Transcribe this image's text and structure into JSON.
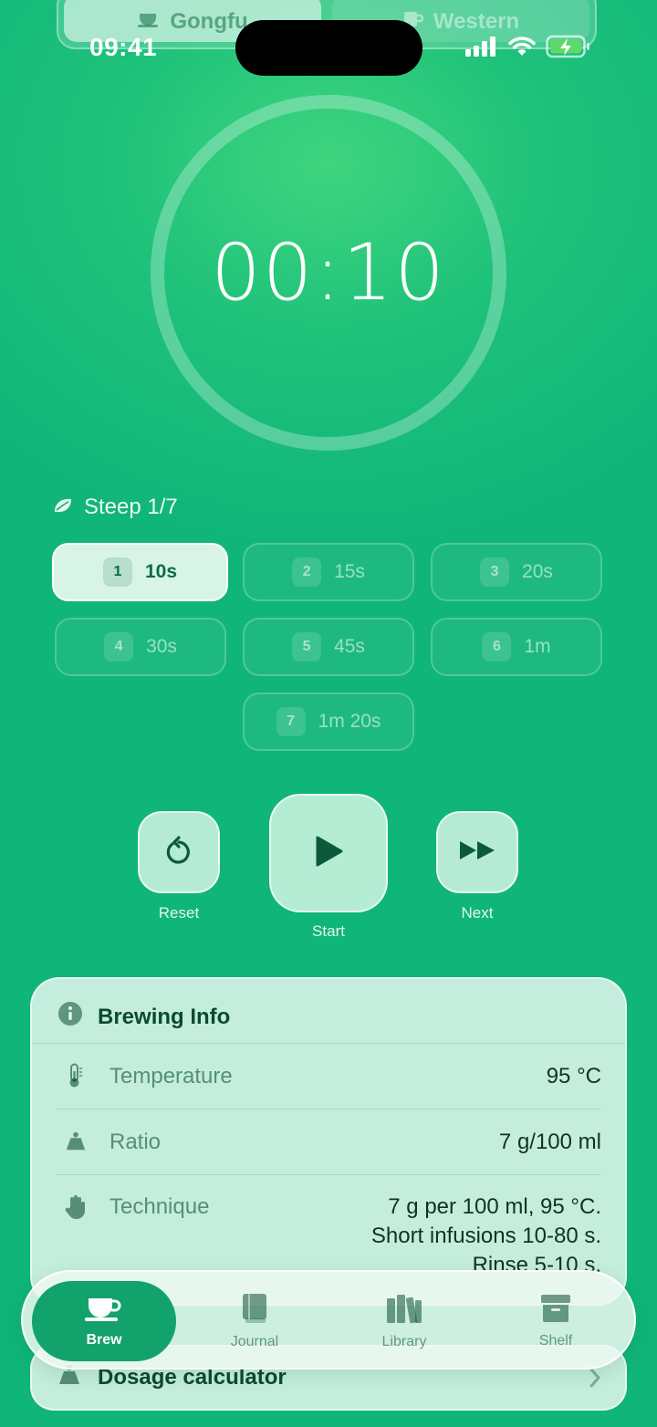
{
  "mode_selector": {
    "options": [
      "Gongfu",
      "Western"
    ],
    "selected": "Gongfu"
  },
  "status_bar": {
    "time": "09:41"
  },
  "timer": {
    "display": "00:10"
  },
  "steep": {
    "label": "Steep 1/7",
    "chips": [
      {
        "num": "1",
        "time": "10s",
        "active": true
      },
      {
        "num": "2",
        "time": "15s",
        "active": false
      },
      {
        "num": "3",
        "time": "20s",
        "active": false
      },
      {
        "num": "4",
        "time": "30s",
        "active": false
      },
      {
        "num": "5",
        "time": "45s",
        "active": false
      },
      {
        "num": "6",
        "time": "1m",
        "active": false
      },
      {
        "num": "7",
        "time": "1m 20s",
        "active": false
      }
    ]
  },
  "controls": {
    "reset_label": "Reset",
    "start_label": "Start",
    "next_label": "Next"
  },
  "brewing_info": {
    "title": "Brewing Info",
    "temperature_label": "Temperature",
    "temperature_value": "95 °C",
    "ratio_label": "Ratio",
    "ratio_value": "7 g/100 ml",
    "technique_label": "Technique",
    "technique_lines": [
      "7 g per 100 ml, 95 °C.",
      "Short infusions 10-80 s.",
      "Rinse 5-10 s."
    ]
  },
  "dosage_calculator": {
    "label": "Dosage calculator"
  },
  "tabs": [
    {
      "label": "Brew",
      "active": true
    },
    {
      "label": "Journal",
      "active": false
    },
    {
      "label": "Library",
      "active": false
    },
    {
      "label": "Shelf",
      "active": false
    }
  ],
  "colors": {
    "background": "#10b57a",
    "accent": "#12a26b",
    "dark_text": "#0b4a32"
  }
}
